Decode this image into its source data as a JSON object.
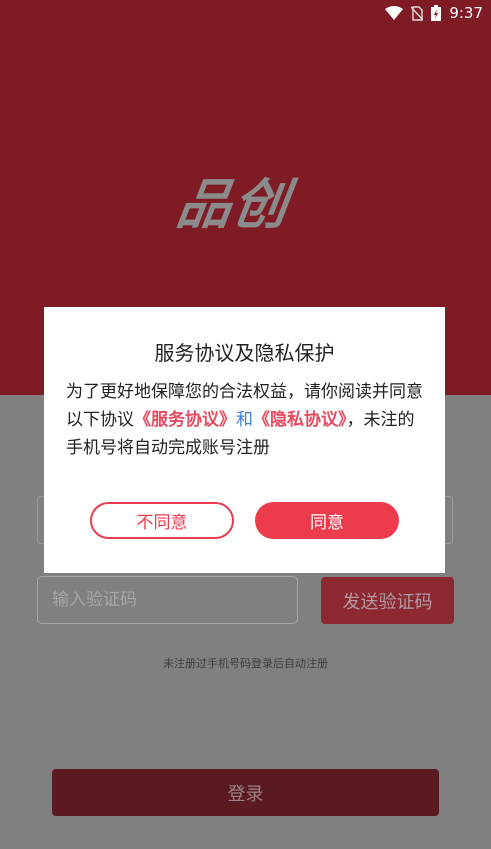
{
  "status_bar": {
    "time": "9:37",
    "icons": [
      "wifi-icon",
      "no-sim-icon",
      "battery-charging-icon"
    ]
  },
  "brand": {
    "logo_text": "品创"
  },
  "form": {
    "code_placeholder": "输入验证码",
    "send_code_label": "发送验证码",
    "hint": "未注册过手机号码登录后自动注册",
    "login_label": "登录"
  },
  "dialog": {
    "title": "服务协议及隐私保护",
    "body_prefix": "为了更好地保障您的合法权益，请你阅读并同意以下协议",
    "service_link": "《服务协议》",
    "and": "和",
    "privacy_link": "《隐私协议》",
    "body_suffix": "，未注的手机号将自动完成账号注册",
    "disagree_label": "不同意",
    "agree_label": "同意"
  },
  "colors": {
    "brand_red": "#7f1b25",
    "accent": "#ec3b4c",
    "link_blue": "#3f7fd6"
  }
}
